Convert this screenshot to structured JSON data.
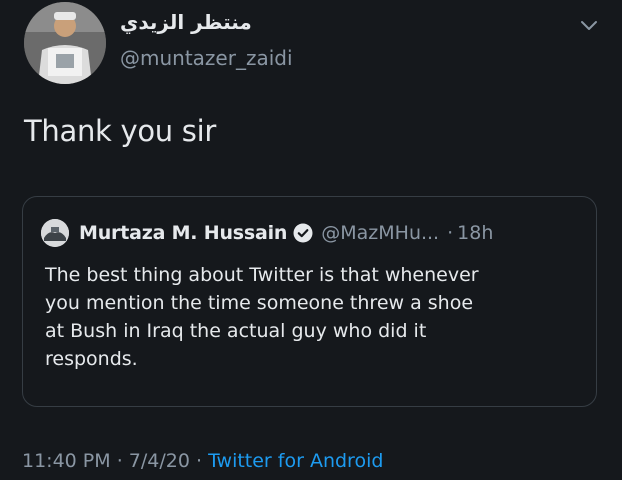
{
  "author": {
    "display_name": "منتظر الزيدي",
    "handle": "@muntazer_zaidi"
  },
  "tweet": {
    "text": "Thank you sir"
  },
  "quoted_tweet": {
    "name": "Murtaza M. Hussain",
    "handle": "@MazMHu...",
    "separator": "·",
    "time": "18h",
    "lines": [
      "The best thing about Twitter is that whenever",
      "you mention the time someone threw a shoe",
      "at Bush in Iraq the actual guy who did it",
      "responds."
    ]
  },
  "footer": {
    "time": "11:40 PM",
    "sep1": " · ",
    "date": "7/4/20",
    "sep2": " · ",
    "source": "Twitter for Android"
  },
  "icons": {
    "caret": "chevron-down-icon",
    "verified": "verified-badge-icon"
  },
  "colors": {
    "background": "#15181c",
    "text": "#e6e9ec",
    "muted": "#8a96a3",
    "link": "#1d9bf0",
    "border": "#363d44"
  }
}
